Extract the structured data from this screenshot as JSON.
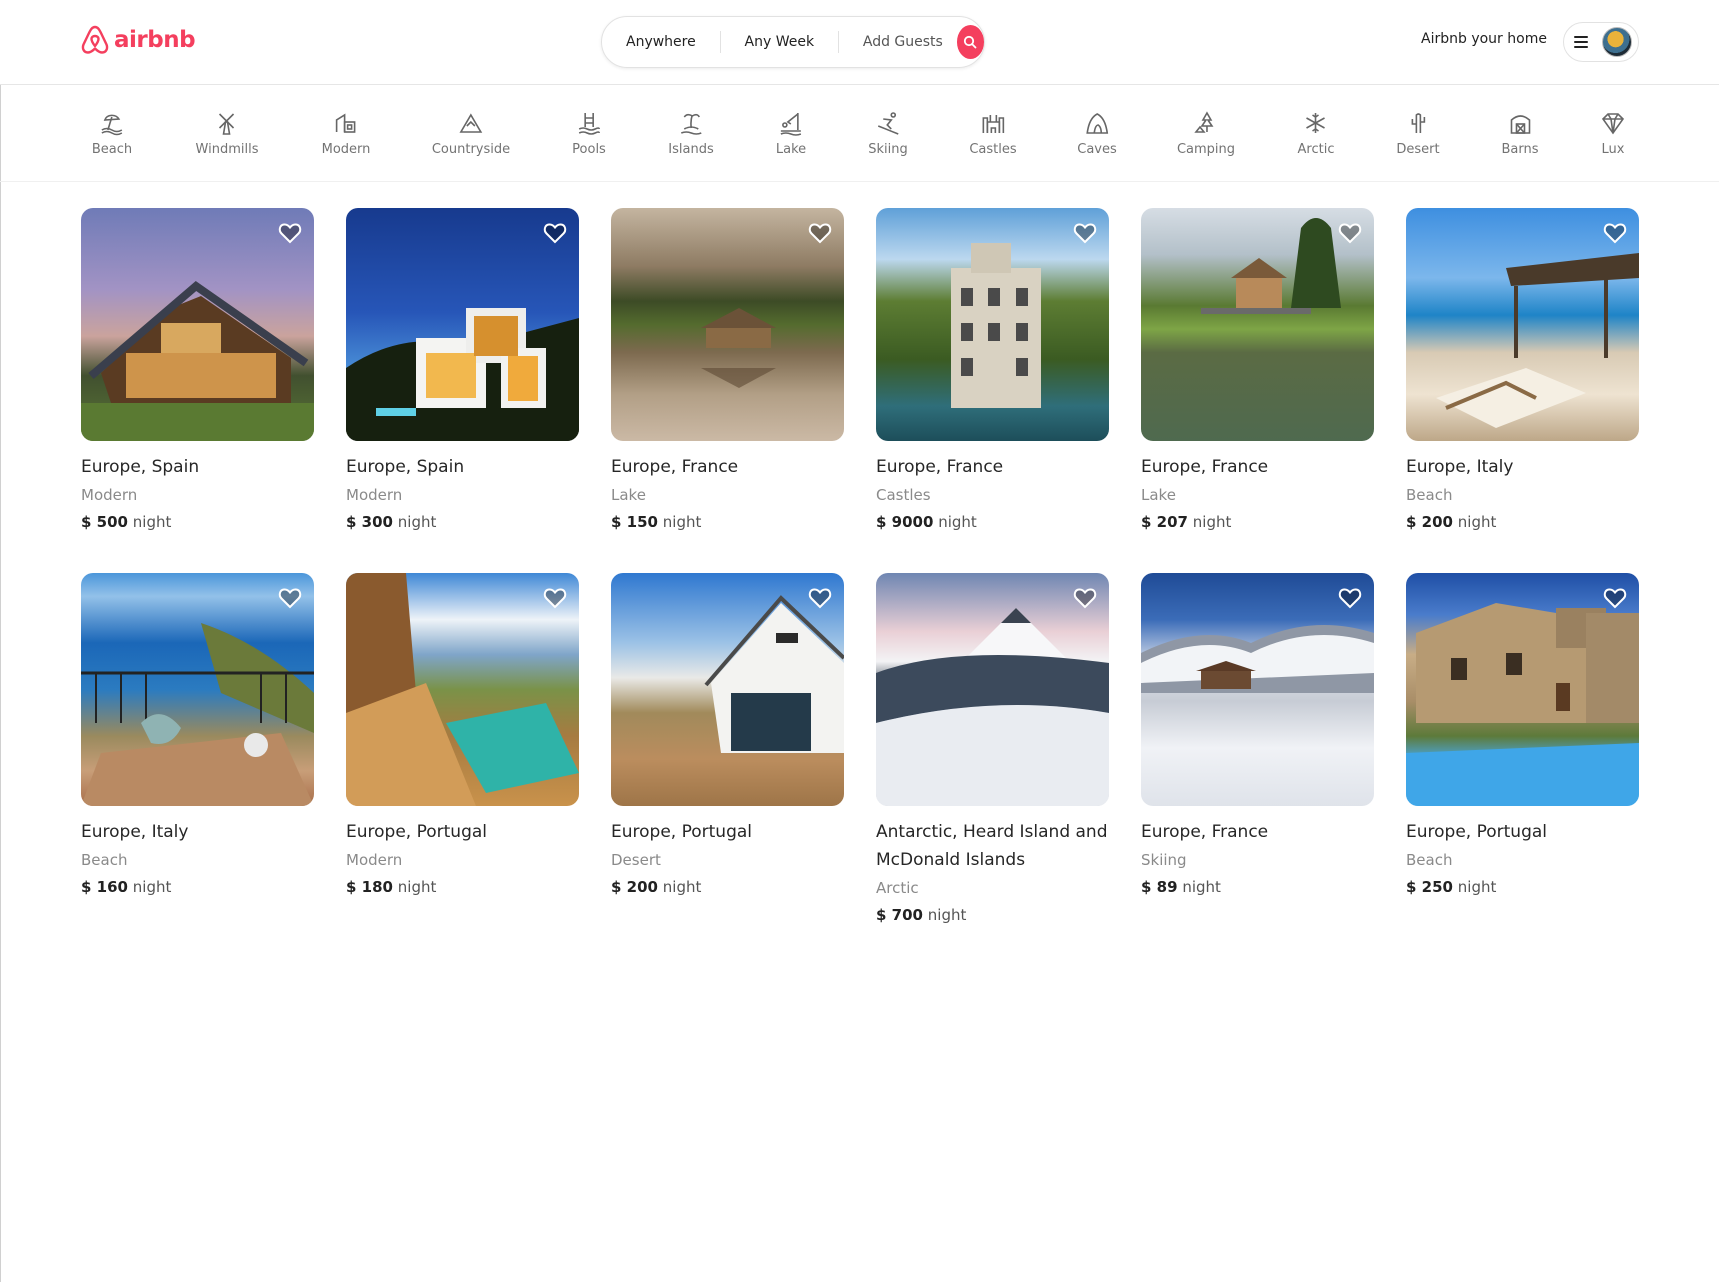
{
  "header": {
    "logo_text": "airbnb",
    "search": {
      "anywhere": "Anywhere",
      "any_week": "Any Week",
      "add_guests": "Add Guests"
    },
    "host_link": "Airbnb your home"
  },
  "categories": [
    {
      "label": "Beach",
      "icon": "beach-icon"
    },
    {
      "label": "Windmills",
      "icon": "windmill-icon"
    },
    {
      "label": "Modern",
      "icon": "modern-building-icon"
    },
    {
      "label": "Countryside",
      "icon": "mountain-icon"
    },
    {
      "label": "Pools",
      "icon": "pool-icon"
    },
    {
      "label": "Islands",
      "icon": "island-icon"
    },
    {
      "label": "Lake",
      "icon": "lake-icon"
    },
    {
      "label": "Skiing",
      "icon": "skiing-icon"
    },
    {
      "label": "Castles",
      "icon": "castle-icon"
    },
    {
      "label": "Caves",
      "icon": "cave-icon"
    },
    {
      "label": "Camping",
      "icon": "camping-icon"
    },
    {
      "label": "Arctic",
      "icon": "snowflake-icon"
    },
    {
      "label": "Desert",
      "icon": "cactus-icon"
    },
    {
      "label": "Barns",
      "icon": "barn-icon"
    },
    {
      "label": "Lux",
      "icon": "diamond-icon"
    }
  ],
  "listings": [
    {
      "location": "Europe, Spain",
      "category": "Modern",
      "price": "$ 500",
      "unit": "night"
    },
    {
      "location": "Europe, Spain",
      "category": "Modern",
      "price": "$ 300",
      "unit": "night"
    },
    {
      "location": "Europe, France",
      "category": "Lake",
      "price": "$ 150",
      "unit": "night"
    },
    {
      "location": "Europe, France",
      "category": "Castles",
      "price": "$ 9000",
      "unit": "night"
    },
    {
      "location": "Europe, France",
      "category": "Lake",
      "price": "$ 207",
      "unit": "night"
    },
    {
      "location": "Europe, Italy",
      "category": "Beach",
      "price": "$ 200",
      "unit": "night"
    },
    {
      "location": "Europe, Italy",
      "category": "Beach",
      "price": "$ 160",
      "unit": "night"
    },
    {
      "location": "Europe, Portugal",
      "category": "Modern",
      "price": "$ 180",
      "unit": "night"
    },
    {
      "location": "Europe, Portugal",
      "category": "Desert",
      "price": "$ 200",
      "unit": "night"
    },
    {
      "location": "Antarctic, Heard Island and McDonald Islands",
      "category": "Arctic",
      "price": "$ 700",
      "unit": "night"
    },
    {
      "location": "Europe, France",
      "category": "Skiing",
      "price": "$ 89",
      "unit": "night"
    },
    {
      "location": "Europe, Portugal",
      "category": "Beach",
      "price": "$ 250",
      "unit": "night"
    }
  ],
  "colors": {
    "brand": "#f43f5e",
    "text": "#222222",
    "muted": "#8a8a8a"
  }
}
